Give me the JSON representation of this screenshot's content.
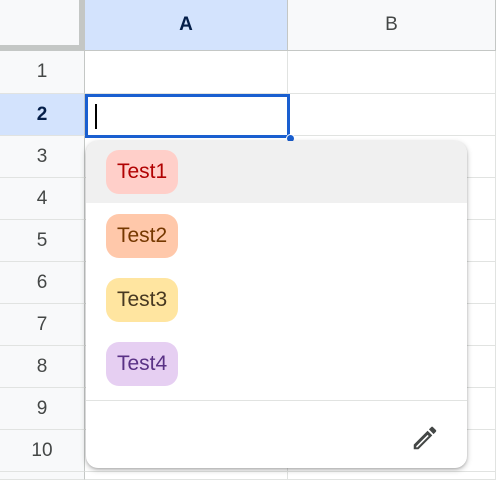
{
  "columns": [
    "A",
    "B"
  ],
  "rows": [
    "1",
    "2",
    "3",
    "4",
    "5",
    "6",
    "7",
    "8",
    "9",
    "10"
  ],
  "active_cell": {
    "column": "A",
    "row": "2",
    "value": ""
  },
  "dropdown": {
    "options": [
      {
        "label": "Test1",
        "bg": "#ffcfc9",
        "fg": "#b10202"
      },
      {
        "label": "Test2",
        "bg": "#ffc8aa",
        "fg": "#753800"
      },
      {
        "label": "Test3",
        "bg": "#ffe5a0",
        "fg": "#473821"
      },
      {
        "label": "Test4",
        "bg": "#e6cff2",
        "fg": "#5a3286"
      }
    ],
    "hovered_option": "Test1",
    "edit_icon": "pencil-icon"
  },
  "colors": {
    "selection": "#1a5fd0",
    "header_active_bg": "#d3e3fd",
    "header_bg": "#f8f9fa"
  }
}
